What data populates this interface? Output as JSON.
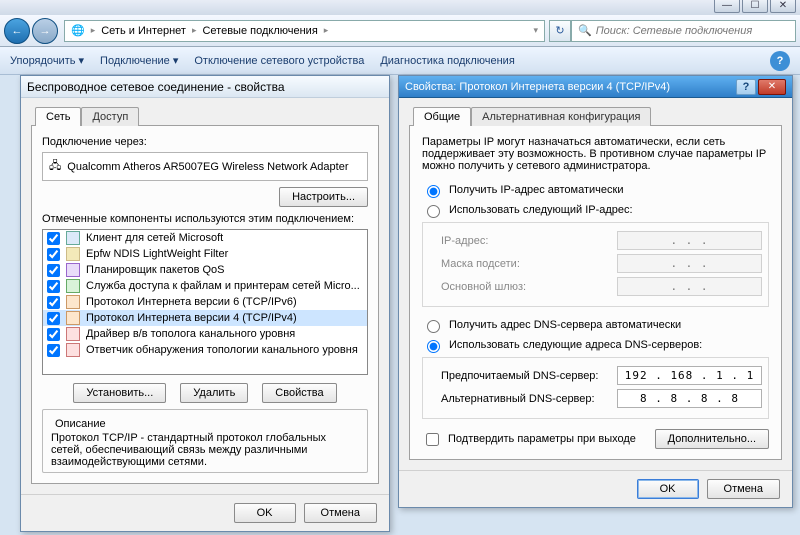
{
  "window_controls": {
    "min": "—",
    "max": "☐",
    "close": "✕"
  },
  "nav": {
    "back": "←",
    "fwd": "→",
    "refresh": "↻"
  },
  "breadcrumb": {
    "icon_name": "network-icon",
    "item1": "Сеть и Интернет",
    "item2": "Сетевые подключения"
  },
  "search": {
    "icon": "🔍",
    "placeholder": "Поиск: Сетевые подключения"
  },
  "menubar": {
    "organize": "Упорядочить ▾",
    "connect": "Подключение ▾",
    "disable": "Отключение сетевого устройства",
    "diagnose": "Диагностика подключения"
  },
  "dlg_left": {
    "title": "Беспроводное сетевое соединение - свойства",
    "tabs": {
      "network": "Сеть",
      "access": "Доступ"
    },
    "connect_via": "Подключение через:",
    "adapter": "Qualcomm Atheros AR5007EG Wireless Network Adapter",
    "configure": "Настроить...",
    "components_label": "Отмеченные компоненты используются этим подключением:",
    "items": [
      "Клиент для сетей Microsoft",
      "Epfw NDIS LightWeight Filter",
      "Планировщик пакетов QoS",
      "Служба доступа к файлам и принтерам сетей Micro...",
      "Протокол Интернета версии 6 (TCP/IPv6)",
      "Протокол Интернета версии 4 (TCP/IPv4)",
      "Драйвер в/в тополога канального уровня",
      "Ответчик обнаружения топологии канального уровня"
    ],
    "install": "Установить...",
    "uninstall": "Удалить",
    "properties": "Свойства",
    "desc_title": "Описание",
    "desc": "Протокол TCP/IP - стандартный протокол глобальных сетей, обеспечивающий связь между различными взаимодействующими сетями.",
    "ok": "OK",
    "cancel": "Отмена"
  },
  "dlg_right": {
    "title": "Свойства: Протокол Интернета версии 4 (TCP/IPv4)",
    "tabs": {
      "general": "Общие",
      "alt": "Альтернативная конфигурация"
    },
    "intro": "Параметры IP могут назначаться автоматически, если сеть поддерживает эту возможность. В противном случае параметры IP можно получить у сетевого администратора.",
    "ip_auto": "Получить IP-адрес автоматически",
    "ip_manual": "Использовать следующий IP-адрес:",
    "ip_label": "IP-адрес:",
    "mask_label": "Маска подсети:",
    "gw_label": "Основной шлюз:",
    "ip_placeholder": ".       .       .",
    "dns_auto": "Получить адрес DNS-сервера автоматически",
    "dns_manual": "Использовать следующие адреса DNS-серверов:",
    "dns_pref": "Предпочитаемый DNS-сервер:",
    "dns_alt": "Альтернативный DNS-сервер:",
    "dns_pref_val": "192 . 168 .  1  .  1",
    "dns_alt_val": "8  .  8  .  8  .  8",
    "confirm": "Подтвердить параметры при выходе",
    "advanced": "Дополнительно...",
    "ok": "OK",
    "cancel": "Отмена"
  }
}
